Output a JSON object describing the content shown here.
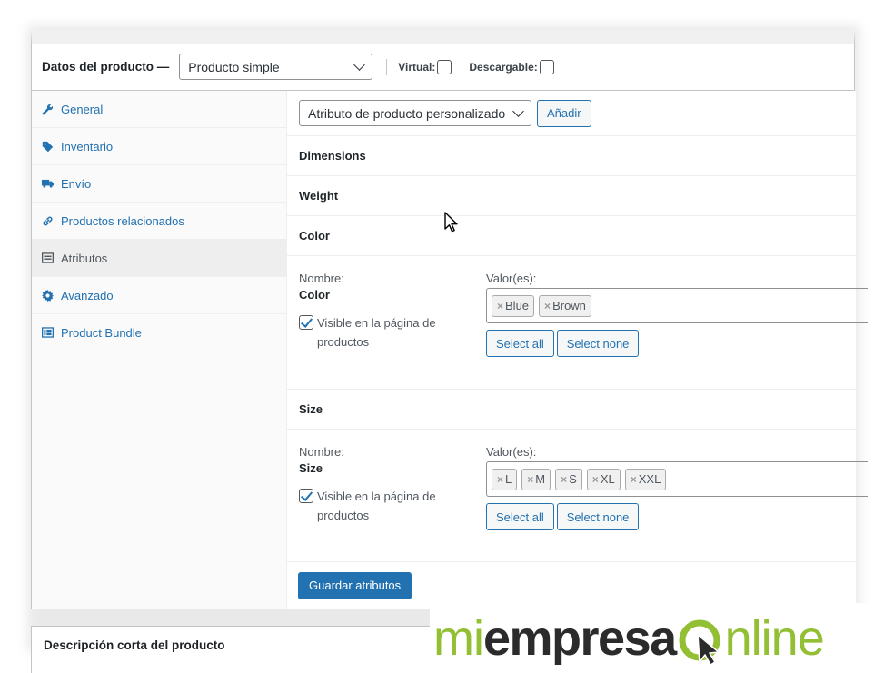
{
  "header": {
    "title": "Datos del producto —",
    "product_type": "Producto simple",
    "virtual_label": "Virtual:",
    "downloadable_label": "Descargable:"
  },
  "tabs": [
    {
      "label": "General",
      "icon": "wrench-icon"
    },
    {
      "label": "Inventario",
      "icon": "tag-icon"
    },
    {
      "label": "Envío",
      "icon": "truck-icon"
    },
    {
      "label": "Productos relacionados",
      "icon": "link-icon"
    },
    {
      "label": "Atributos",
      "icon": "list-icon",
      "active": true
    },
    {
      "label": "Avanzado",
      "icon": "gear-icon"
    },
    {
      "label": "Product Bundle",
      "icon": "bundle-icon"
    }
  ],
  "toolbar": {
    "attribute_select": "Atributo de producto personalizado",
    "add_label": "Añadir"
  },
  "attributes": [
    {
      "name": "Dimensions"
    },
    {
      "name": "Weight"
    },
    {
      "name": "Color",
      "name_label": "Nombre:",
      "values_label": "Valor(es):",
      "visible_label": "Visible en la página de productos",
      "values": [
        "Blue",
        "Brown"
      ],
      "select_all": "Select all",
      "select_none": "Select none"
    },
    {
      "name": "Size",
      "name_label": "Nombre:",
      "values_label": "Valor(es):",
      "visible_label": "Visible en la página de productos",
      "values": [
        "L",
        "M",
        "S",
        "XL",
        "XXL"
      ],
      "select_all": "Select all",
      "select_none": "Select none"
    }
  ],
  "save_label": "Guardar atributos",
  "next_panel_title": "Descripción corta del producto",
  "logo": {
    "part1": "mi",
    "part2": "empresa",
    "part3": "nline",
    "green": "#93bf34",
    "dark": "#2b2b2b"
  },
  "colors": {
    "link": "#2271b1",
    "primary_button": "#2271b1"
  }
}
